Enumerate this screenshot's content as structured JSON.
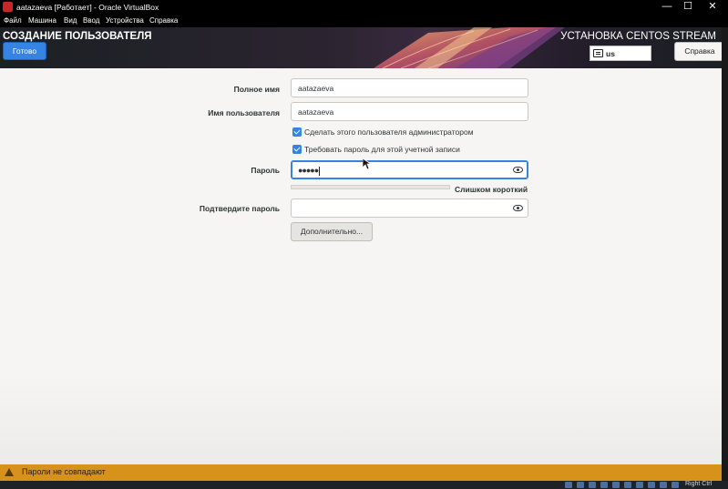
{
  "window": {
    "title": "aatazaeva [Работает] - Oracle VirtualBox",
    "controls": {
      "minimize": "—",
      "maximize": "☐",
      "close": "✕"
    }
  },
  "menubar": [
    "Файл",
    "Машина",
    "Вид",
    "Ввод",
    "Устройства",
    "Справка"
  ],
  "header": {
    "spoke_title": "СОЗДАНИЕ ПОЛЬЗОВАТЕЛЯ",
    "done_label": "Готово",
    "product_title": "УСТАНОВКА CENTOS STREAM",
    "keyboard_layout": "us",
    "help_label": "Справка"
  },
  "form": {
    "full_name_label": "Полное имя",
    "full_name_value": "aatazaeva",
    "username_label": "Имя пользователя",
    "username_value": "aatazaeva",
    "admin_checkbox_label": "Сделать этого пользователя администратором",
    "admin_checked": true,
    "require_password_label": "Требовать пароль для этой учетной записи",
    "require_password_checked": true,
    "password_label": "Пароль",
    "password_mask": "●●●●●",
    "strength_text": "Слишком короткий",
    "strength_level": 0.0,
    "confirm_label": "Подтвердите пароль",
    "confirm_value": "",
    "advanced_label": "Дополнительно..."
  },
  "warning": {
    "text": "Пароли не совпадают"
  },
  "statusbar": {
    "host_key": "Right Ctrl"
  },
  "colors": {
    "accent": "#3584e4",
    "warning_bar": "#d7921b",
    "header_bg": "#1a1e22"
  }
}
